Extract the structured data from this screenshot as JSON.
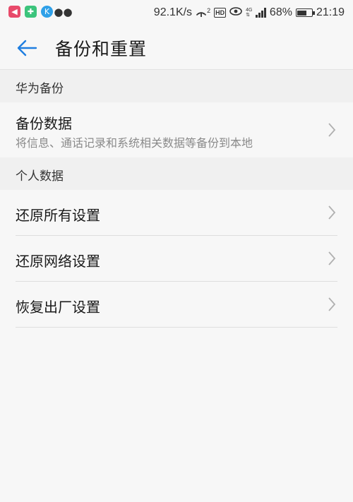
{
  "status_bar": {
    "net_speed": "92.1K/s",
    "hd": "HD",
    "signal_type": "4G",
    "battery": "68%",
    "battery_level": 0.68,
    "time": "21:19",
    "hotspot_count": "2"
  },
  "header": {
    "title": "备份和重置"
  },
  "sections": [
    {
      "title": "华为备份",
      "items": [
        {
          "title": "备份数据",
          "subtitle": "将信息、通话记录和系统相关数据等备份到本地"
        }
      ]
    },
    {
      "title": "个人数据",
      "items": [
        {
          "title": "还原所有设置"
        },
        {
          "title": "还原网络设置"
        },
        {
          "title": "恢复出厂设置"
        }
      ]
    }
  ],
  "colors": {
    "accent": "#1f7ee0",
    "background": "#f7f7f7",
    "section_bg": "#f0f0f0"
  }
}
